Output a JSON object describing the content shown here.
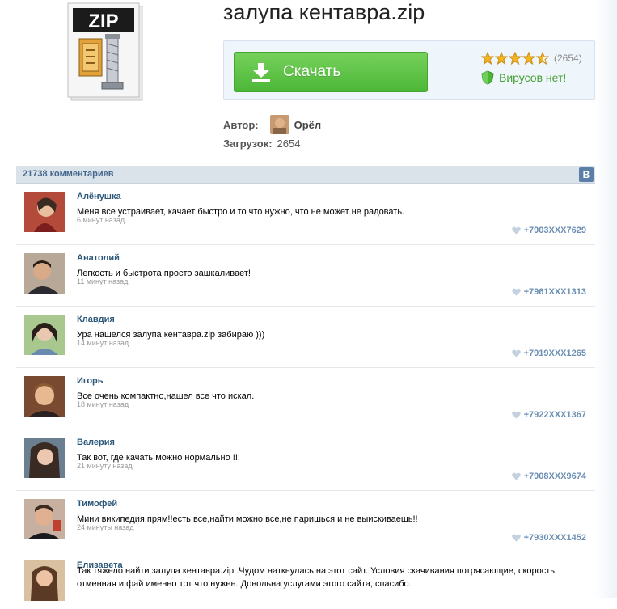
{
  "file": {
    "title": "залупа кентавра.zip",
    "icon": "zip-archive-icon",
    "icon_label": "ZIP"
  },
  "download": {
    "button_label": "Скачать",
    "rating_stars": 4.5,
    "rating_max": 5,
    "rating_count": "(2654)",
    "virus_text": "Вирусов нет!"
  },
  "meta": {
    "author_label": "Автор:",
    "author_name": "Орёл",
    "downloads_label": "Загрузок:",
    "downloads_value": "2654"
  },
  "comments_header": {
    "count_label": "21738 комментариев",
    "vk_logo": "В"
  },
  "comments": [
    {
      "name": "Алёнушка",
      "text": "Меня все устраивает, качает быстро и то что нужно, что не может не радовать.",
      "time": "6 минут назад",
      "phone": "+7903XXX7629",
      "avatar_color": "#b44a3a"
    },
    {
      "name": "Анатолий",
      "text": "Легкость и быстрота просто зашкаливает!",
      "time": "11 минут назад",
      "phone": "+7961XXX1313",
      "avatar_color": "#8a7263"
    },
    {
      "name": "Клавдия",
      "text": "Ура нашелся залупа кентавра.zip забираю )))",
      "time": "14 минут назад",
      "phone": "+7919XXX1265",
      "avatar_color": "#6d8f4e"
    },
    {
      "name": "Игорь",
      "text": "Все очень компактно,нашел все что искал.",
      "time": "18 минут назад",
      "phone": "+7922XXX1367",
      "avatar_color": "#c28a5a"
    },
    {
      "name": "Валерия",
      "text": "Так вот, где качать можно нормально !!!",
      "time": "21 минуту назад",
      "phone": "+7908XXX9674",
      "avatar_color": "#4a3a34"
    },
    {
      "name": "Тимофей",
      "text": "Мини википедия прям!!есть все,найти можно все,не паришься и не выискиваешь!!",
      "time": "24 минуты назад",
      "phone": "+7930XXX1452",
      "avatar_color": "#7a4a3a"
    },
    {
      "name": "Елизавета",
      "text": "Так тяжело найти залупа кентавра.zip .Чудом наткнулась на этот сайт. Условия скачивания потрясающие, скорость отменная и фай именно тот что нужен. Довольна услугами этого сайта, спасибо.",
      "time": "",
      "phone": "",
      "avatar_color": "#a8764a"
    }
  ],
  "colors": {
    "accent_green": "#4cb737",
    "link_blue": "#2b587a",
    "phone_blue": "#6b8fb4",
    "header_bg": "#dae2ea"
  }
}
